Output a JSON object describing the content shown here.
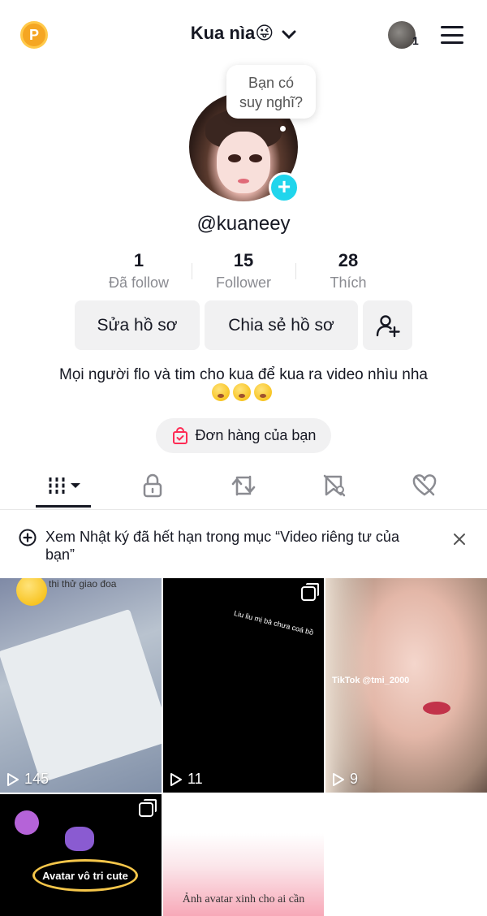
{
  "header": {
    "title": "Kua nìa😜",
    "coin_letter": "P",
    "friend_count": "1"
  },
  "profile": {
    "bubble_text_line1": "Bạn có",
    "bubble_text_line2": "suy nghĩ?",
    "username": "@kuaneey",
    "stats": [
      {
        "value": "1",
        "label": "Đã follow"
      },
      {
        "value": "15",
        "label": "Follower"
      },
      {
        "value": "28",
        "label": "Thích"
      }
    ],
    "edit_button": "Sửa hồ sơ",
    "share_button": "Chia sẻ hồ sơ",
    "bio": "Mọi người flo và tim cho kua để kua ra video nhìu nha",
    "order_label": "Đơn hàng của bạn"
  },
  "tabs": [
    {
      "icon": "videos-grid-icon"
    },
    {
      "icon": "lock-icon"
    },
    {
      "icon": "repost-icon"
    },
    {
      "icon": "favorites-icon"
    },
    {
      "icon": "liked-icon"
    }
  ],
  "notice": {
    "text": "Xem Nhật ký đã hết hạn trong mục “Video riêng tư của bạn”"
  },
  "videos": [
    {
      "views": "145",
      "caption": "",
      "overlay_top": "thi thử giao đoa"
    },
    {
      "views": "11",
      "caption": "Liu liu mị bà chưa coá bồ"
    },
    {
      "views": "9",
      "caption": "TikTok @tmi_2000"
    },
    {
      "views": "",
      "caption": "Avatar vô tri cute"
    },
    {
      "views": "",
      "caption": "Ảnh avatar xinh cho ai cần"
    }
  ],
  "colors": {
    "accent_cyan": "#20d5ec",
    "coin": "#f5a623",
    "order_icon": "#fe2c55"
  }
}
